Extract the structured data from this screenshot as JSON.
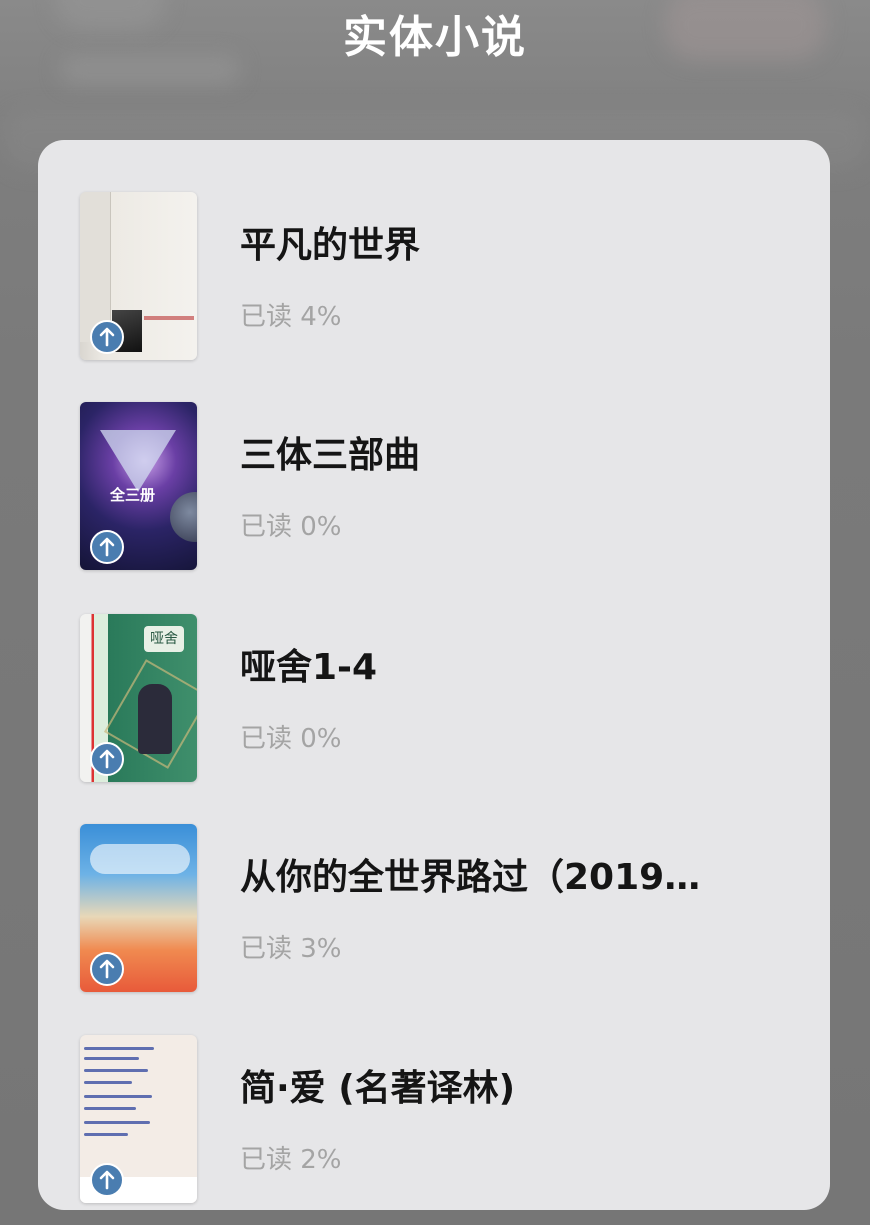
{
  "folder": {
    "title": "实体小说"
  },
  "books": [
    {
      "title": "平凡的世界",
      "progress": "已读 4%",
      "upload_icon": "arrow-up-icon"
    },
    {
      "title": "三体三部曲",
      "progress": "已读 0%",
      "cover_text": "全三册",
      "upload_icon": "arrow-up-icon"
    },
    {
      "title": "哑舍1-4",
      "progress": "已读 0%",
      "cover_text": "哑舍",
      "upload_icon": "arrow-up-icon"
    },
    {
      "title": "从你的全世界路过（2019…",
      "progress": "已读 3%",
      "upload_icon": "arrow-up-icon"
    },
    {
      "title": "简·爱 (名著译林)",
      "progress": "已读 2%",
      "upload_icon": "arrow-up-icon"
    }
  ],
  "colors": {
    "panel_bg": "#e6e6e8",
    "title_text": "#151515",
    "progress_text": "#a4a4a4",
    "upload_badge": "#4a7db0"
  }
}
